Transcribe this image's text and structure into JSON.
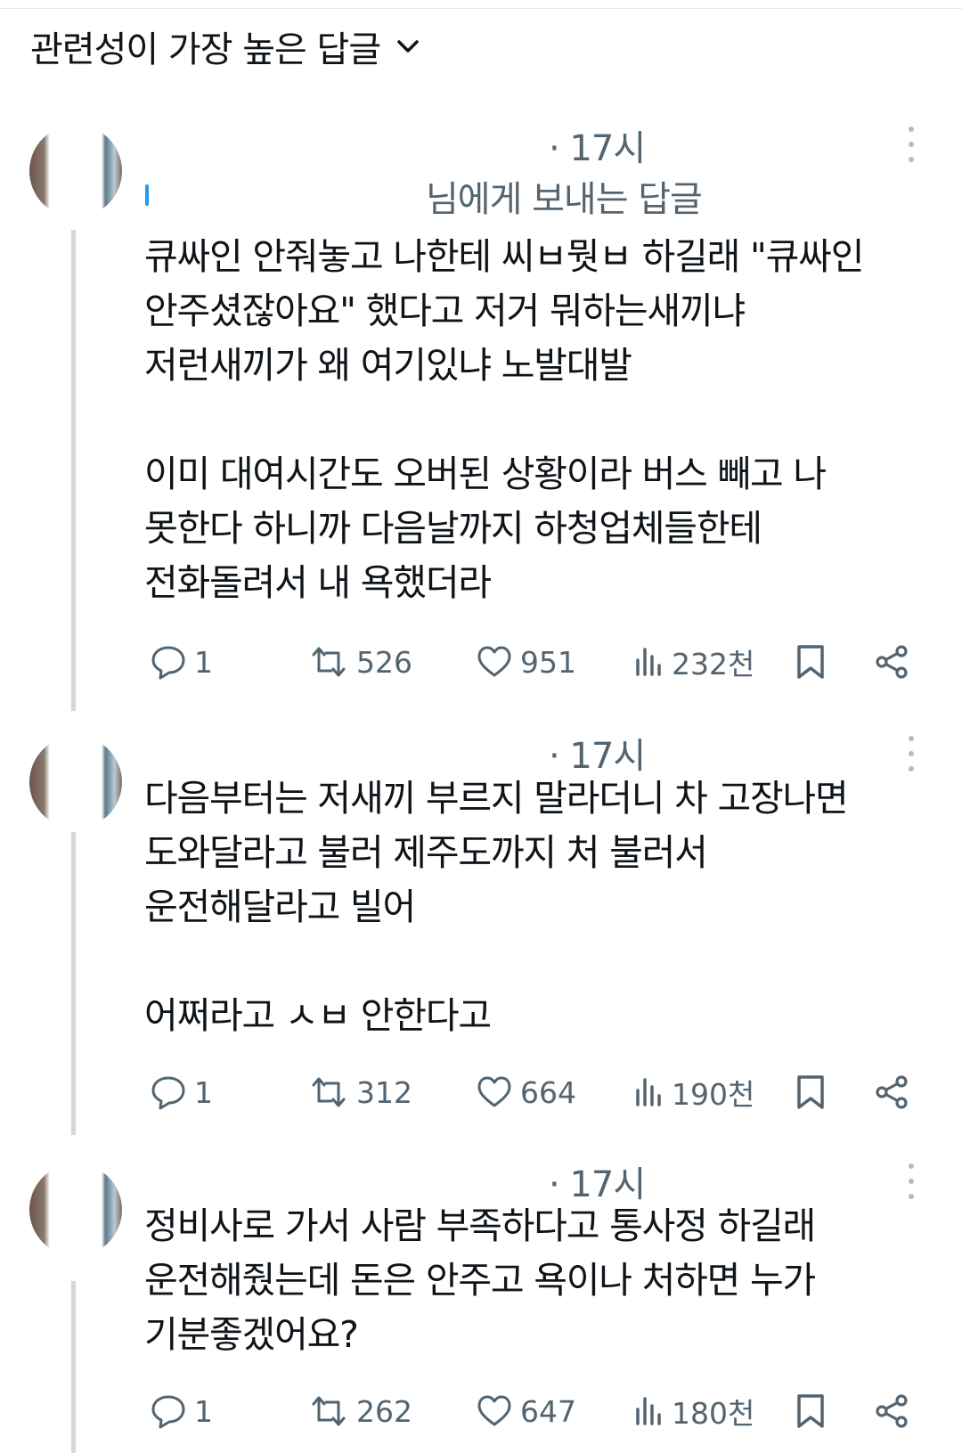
{
  "sort": {
    "label": "관련성이 가장 높은 답글"
  },
  "replies": [
    {
      "time": "· 17시",
      "replying_to": "님에게 보내는 답글",
      "text": "큐싸인 안줘놓고 나한테 씨ㅂ뭣ㅂ 하길래 \"큐싸인\n안주셨잖아요\" 했다고 저거 뭐하는새끼냐\n저런새끼가 왜 여기있냐 노발대발\n\n이미 대여시간도 오버된 상황이라 버스 빼고 나\n못한다 하니까 다음날까지 하청업체들한테\n전화돌려서 내 욕했더라",
      "stats": {
        "replies": "1",
        "reposts": "526",
        "likes": "951",
        "views": "232천"
      }
    },
    {
      "time": "· 17시",
      "text": "다음부터는 저새끼 부르지 말라더니 차 고장나면\n도와달라고 불러 제주도까지 처 불러서\n운전해달라고 빌어\n\n어쩌라고 ㅅㅂ 안한다고",
      "stats": {
        "replies": "1",
        "reposts": "312",
        "likes": "664",
        "views": "190천"
      }
    },
    {
      "time": "· 17시",
      "text": "정비사로 가서 사람 부족하다고 통사정 하길래\n운전해줬는데 돈은 안주고 욕이나 처하면 누가\n기분좋겠어요?",
      "stats": {
        "replies": "1",
        "reposts": "262",
        "likes": "647",
        "views": "180천"
      }
    }
  ],
  "icons": {
    "sort": "chevron-down-icon",
    "more": "more-vertical-icon",
    "reply": "comment-icon",
    "repost": "repost-icon",
    "like": "heart-icon",
    "views": "views-chart-icon",
    "bookmark": "bookmark-icon",
    "share": "share-icon"
  },
  "colors": {
    "secondary_text": "#536471",
    "thread_line": "#cfd9de",
    "text": "#0f1419"
  }
}
